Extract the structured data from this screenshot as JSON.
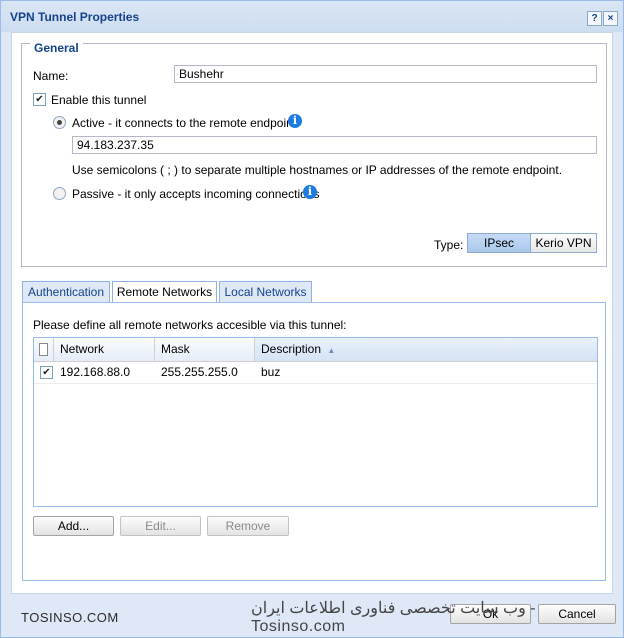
{
  "window": {
    "title": "VPN Tunnel Properties",
    "help_label": "?",
    "close_label": "×"
  },
  "general": {
    "legend": "General",
    "name_label": "Name:",
    "name_value": "Bushehr",
    "enable_label": "Enable this tunnel",
    "enable_checked": true,
    "active_label": "Active - it connects to the remote endpoint",
    "endpoint_value": "94.183.237.35",
    "hint": "Use semicolons ( ; ) to separate multiple hostnames or IP addresses of the remote endpoint.",
    "passive_label": "Passive - it only accepts incoming connections",
    "type_label": "Type:",
    "type_options": [
      "IPsec",
      "Kerio VPN"
    ],
    "type_selected": "IPsec",
    "info_glyph": "i"
  },
  "tabs": [
    {
      "label": "Authentication",
      "active": false
    },
    {
      "label": "Remote Networks",
      "active": true
    },
    {
      "label": "Local Networks",
      "active": false
    }
  ],
  "remote_networks": {
    "instruction": "Please define all remote networks accesible via this tunnel:",
    "columns": [
      "Network",
      "Mask",
      "Description"
    ],
    "sort_indicator": "▲",
    "rows": [
      {
        "checked": true,
        "network": "192.168.88.0",
        "mask": "255.255.255.0",
        "description": "buz"
      }
    ],
    "buttons": {
      "add": "Add...",
      "edit": "Edit...",
      "remove": "Remove"
    }
  },
  "footer": {
    "ok": "Ok",
    "cancel": "Cancel"
  },
  "watermark": {
    "left": "TOSINSO.COM",
    "right": "وب سایت تخصصی فناوری اطلاعات ایران - Tosinso.com"
  },
  "colors": {
    "accent": "#15428b",
    "panel_border": "#99bbe8",
    "info": "#1e7be0"
  }
}
